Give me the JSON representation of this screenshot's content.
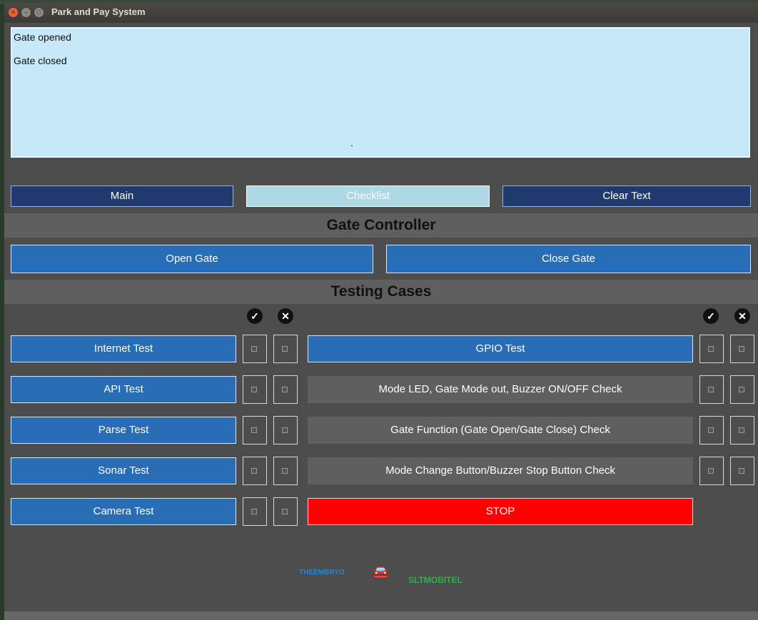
{
  "window": {
    "title": "Park and Pay System"
  },
  "log": {
    "lines": [
      "Gate opened",
      "Gate closed"
    ]
  },
  "nav": {
    "main": "Main",
    "checklist": "Checklist",
    "clear": "Clear Text"
  },
  "gate": {
    "heading": "Gate Controller",
    "open": "Open Gate",
    "close": "Close Gate"
  },
  "testing": {
    "heading": "Testing Cases"
  },
  "tests_left": [
    "Internet Test",
    "API Test",
    "Parse Test",
    "Sonar Test",
    "Camera Test"
  ],
  "tests_right": [
    "GPIO Test",
    "Mode LED, Gate Mode out, Buzzer ON/OFF Check",
    "Gate Function (Gate Open/Gate Close) Check",
    "Mode Change Button/Buzzer Stop Button Check"
  ],
  "stop": "STOP",
  "logos": {
    "left": "THEEMBRYO",
    "right": "SLTMOBITEL"
  },
  "icons": {
    "pass": "check-icon",
    "fail": "cross-icon"
  },
  "colors": {
    "blue": "#2a6db7",
    "nav": "#1e3a6e",
    "stop": "#ff0000",
    "log_bg": "#c6e8f9"
  }
}
